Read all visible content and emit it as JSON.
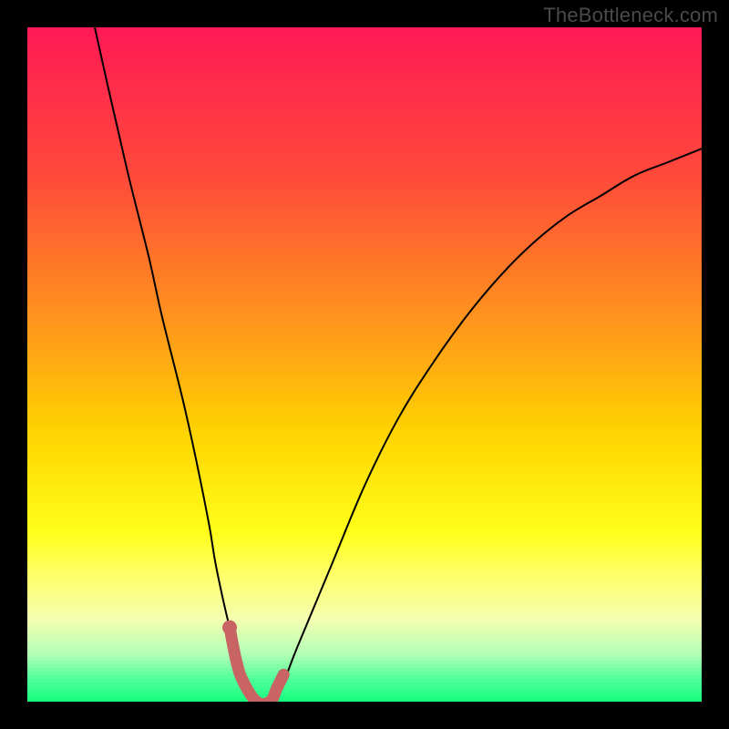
{
  "watermark": {
    "text": "TheBottleneck.com"
  },
  "colors": {
    "black": "#000000",
    "curve": "#000000",
    "marker": "#c86464",
    "gradient_stops": [
      {
        "pct": 0,
        "color": "#ff1a55"
      },
      {
        "pct": 22,
        "color": "#ff4a3a"
      },
      {
        "pct": 45,
        "color": "#ff9a1a"
      },
      {
        "pct": 60,
        "color": "#ffd300"
      },
      {
        "pct": 75,
        "color": "#ffff1a"
      },
      {
        "pct": 82,
        "color": "#ffff70"
      },
      {
        "pct": 88,
        "color": "#f3ffb0"
      },
      {
        "pct": 93,
        "color": "#b6ffb6"
      },
      {
        "pct": 97,
        "color": "#4fff9a"
      },
      {
        "pct": 100,
        "color": "#1aff82"
      }
    ]
  },
  "chart_data": {
    "type": "line",
    "title": "",
    "xlabel": "",
    "ylabel": "",
    "xlim": [
      0,
      100
    ],
    "ylim": [
      0,
      100
    ],
    "series": [
      {
        "name": "bottleneck-curve",
        "x": [
          10,
          12,
          15,
          18,
          20,
          23,
          25,
          27,
          28,
          30,
          32,
          34,
          36,
          38,
          40,
          45,
          50,
          55,
          60,
          65,
          70,
          75,
          80,
          85,
          90,
          95,
          100
        ],
        "y": [
          100,
          91,
          78,
          66,
          57,
          45,
          36,
          26,
          20,
          11,
          4,
          0,
          0,
          3,
          8,
          20,
          32,
          42,
          50,
          57,
          63,
          68,
          72,
          75,
          78,
          80,
          82
        ]
      }
    ],
    "markers": {
      "name": "highlight-segment",
      "color": "#c86464",
      "x": [
        30,
        31,
        32,
        34,
        36,
        37,
        38
      ],
      "y": [
        11,
        6,
        3,
        0,
        0,
        2,
        4
      ]
    },
    "gradient_description": "vertical red-to-green heat gradient; red top (high bottleneck), green bottom (no bottleneck)"
  }
}
